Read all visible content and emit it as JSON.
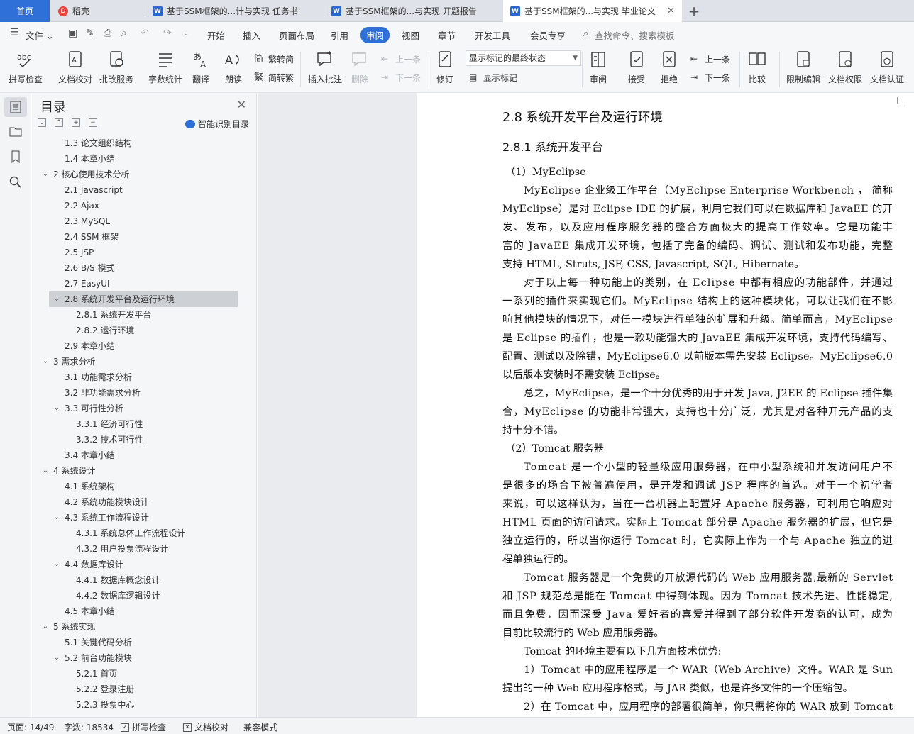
{
  "tabs": {
    "home": "首页",
    "daoke": "稻壳",
    "doc1": "基于SSM框架的...计与实现 任务书",
    "doc2": "基于SSM框架的...与实现 开题报告",
    "doc3": "基于SSM框架的...与实现 毕业论文"
  },
  "menubar": {
    "file": "文件",
    "items": [
      "开始",
      "插入",
      "页面布局",
      "引用",
      "审阅",
      "视图",
      "章节",
      "开发工具",
      "会员专享"
    ],
    "search": "查找命令、搜索模板"
  },
  "ribbon": {
    "spell_check": "拼写检查",
    "doc_proof": "文档校对",
    "review_service": "批改服务",
    "word_count": "字数统计",
    "translate": "翻译",
    "read_aloud": "朗读",
    "simp_to_trad": "繁转简",
    "trad_to_simp": "简转繁",
    "insert_comment": "插入批注",
    "delete": "删除",
    "prev": "上一条",
    "next": "下一条",
    "track_changes": "修订",
    "display_state": "显示标记的最终状态",
    "show_markup": "显示标记",
    "review": "审阅",
    "accept": "接受",
    "reject": "拒绝",
    "prev2": "上一条",
    "next2": "下一条",
    "compare": "比较",
    "restrict_edit": "限制编辑",
    "doc_permission": "文档权限",
    "doc_certify": "文档认证"
  },
  "toc": {
    "title": "目录",
    "smart": "智能识别目录",
    "items": [
      {
        "text": "1.3  论文组织结构",
        "level": 2
      },
      {
        "text": "1.4  本章小结",
        "level": 2
      },
      {
        "text": "2  核心使用技术分析",
        "level": 1,
        "expanded": true
      },
      {
        "text": "2.1 Javascript",
        "level": 2
      },
      {
        "text": "2.2 Ajax",
        "level": 2
      },
      {
        "text": "2.3 MySQL",
        "level": 2
      },
      {
        "text": "2.4 SSM 框架",
        "level": 2
      },
      {
        "text": "2.5 JSP",
        "level": 2
      },
      {
        "text": "2.6 B/S 模式",
        "level": 2
      },
      {
        "text": "2.7 EasyUI",
        "level": 2
      },
      {
        "text": "2.8  系统开发平台及运行环境",
        "level": 2,
        "expanded": true,
        "selected": true
      },
      {
        "text": "2.8.1  系统开发平台",
        "level": 3
      },
      {
        "text": "2.8.2  运行环境",
        "level": 3
      },
      {
        "text": "2.9  本章小结",
        "level": 2
      },
      {
        "text": "3  需求分析",
        "level": 1,
        "expanded": true
      },
      {
        "text": "3.1  功能需求分析",
        "level": 2
      },
      {
        "text": "3.2  非功能需求分析",
        "level": 2
      },
      {
        "text": "3.3  可行性分析",
        "level": 2,
        "expanded": true
      },
      {
        "text": "3.3.1  经济可行性",
        "level": 3
      },
      {
        "text": "3.3.2  技术可行性",
        "level": 3
      },
      {
        "text": "3.4  本章小结",
        "level": 2
      },
      {
        "text": "4  系统设计",
        "level": 1,
        "expanded": true
      },
      {
        "text": "4.1  系统架构",
        "level": 2
      },
      {
        "text": "4.2  系统功能模块设计",
        "level": 2
      },
      {
        "text": "4.3  系统工作流程设计",
        "level": 2,
        "expanded": true
      },
      {
        "text": "4.3.1  系统总体工作流程设计",
        "level": 3
      },
      {
        "text": "4.3.2  用户投票流程设计",
        "level": 3
      },
      {
        "text": "4.4  数据库设计",
        "level": 2,
        "expanded": true
      },
      {
        "text": "4.4.1  数据库概念设计",
        "level": 3
      },
      {
        "text": "4.4.2  数据库逻辑设计",
        "level": 3
      },
      {
        "text": "4.5  本章小结",
        "level": 2
      },
      {
        "text": "5  系统实现",
        "level": 1,
        "expanded": true
      },
      {
        "text": "5.1  关键代码分析",
        "level": 2
      },
      {
        "text": "5.2  前台功能模块",
        "level": 2,
        "expanded": true
      },
      {
        "text": "5.2.1  首页",
        "level": 3
      },
      {
        "text": "5.2.2  登录注册",
        "level": 3
      },
      {
        "text": "5.2.3  投票中心",
        "level": 3
      }
    ]
  },
  "document": {
    "h2": "2.8  系统开发平台及运行环境",
    "h3": "2.8.1  系统开发平台",
    "lines": [
      "（1）MyEclipse",
      "MyEclipse 企业级工作平台（MyEclipse Enterprise Workbench ， 简称",
      "MyEclipse）是对 Eclipse IDE 的扩展，利用它我们可以在数据库和 JavaEE 的开",
      "发、发布，以及应用程序服务器的整合方面极大的提高工作效率。它是功能丰",
      "富的 JavaEE 集成开发环境，包括了完备的编码、调试、测试和发布功能，完整",
      "支持 HTML, Struts, JSF, CSS, Javascript, SQL, Hibernate。",
      "对于以上每一种功能上的类别，在 Eclipse 中都有相应的功能部件，并通过",
      "一系列的插件来实现它们。MyEclipse 结构上的这种模块化，可以让我们在不影",
      "响其他模块的情况下，对任一模块进行单独的扩展和升级。简单而言，MyEclipse",
      "是 Eclipse 的插件，也是一款功能强大的 JavaEE 集成开发环境，支持代码编写、",
      "配置、测试以及除错，MyEclipse6.0 以前版本需先安装 Eclipse。MyEclipse6.0",
      "以后版本安装时不需安装 Eclipse。",
      "总之，MyEclipse，是一个十分优秀的用于开发 Java, J2EE 的 Eclipse 插件集",
      "合，MyEclipse 的功能非常强大，支持也十分广泛，尤其是对各种开元产品的支",
      "持十分不错。",
      "（2）Tomcat 服务器",
      "Tomcat 是一个小型的轻量级应用服务器，在中小型系统和并发访问用户不",
      "是很多的场合下被普遍使用，是开发和调试 JSP 程序的首选。对于一个初学者",
      "来说，可以这样认为，当在一台机器上配置好 Apache 服务器，可利用它响应对",
      "HTML 页面的访问请求。实际上 Tomcat 部分是 Apache 服务器的扩展，但它是",
      "独立运行的，所以当你运行 Tomcat 时，它实际上作为一个与 Apache 独立的进",
      "程单独运行的。",
      "Tomcat 服务器是一个免费的开放源代码的 Web 应用服务器,最新的 Servlet",
      "和 JSP 规范总是能在 Tomcat 中得到体现。因为 Tomcat 技术先进、性能稳定,",
      "而且免费，因而深受 Java 爱好者的喜爱并得到了部分软件开发商的认可，成为",
      "目前比较流行的 Web 应用服务器。",
      "Tomcat 的环境主要有以下几方面技术优势:",
      "1）Tomcat 中的应用程序是一个 WAR（Web Archive）文件。WAR 是 Sun",
      "提出的一种 Web 应用程序格式，与 JAR 类似，也是许多文件的一个压缩包。",
      "2）在 Tomcat 中，应用程序的部署很简单，你只需将你的 WAR 放到 Tomcat"
    ]
  },
  "statusbar": {
    "page": "页面: 14/49",
    "words": "字数: 18534",
    "spell": "拼写检查",
    "proof": "文档校对",
    "compat": "兼容模式"
  }
}
